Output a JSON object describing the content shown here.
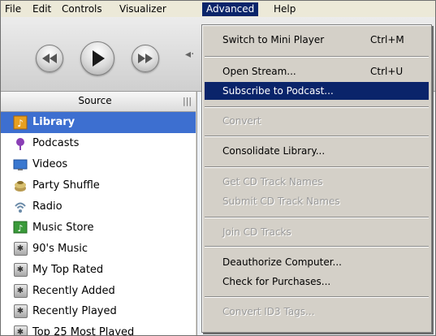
{
  "menubar": {
    "items": [
      {
        "label": "File"
      },
      {
        "label": "Edit"
      },
      {
        "label": "Controls"
      },
      {
        "label": "Visualizer"
      },
      {
        "label": "Advanced"
      },
      {
        "label": "Help"
      }
    ]
  },
  "source": {
    "header": "Source",
    "items": [
      {
        "label": "Library",
        "icon": "library-icon"
      },
      {
        "label": "Podcasts",
        "icon": "podcast-icon"
      },
      {
        "label": "Videos",
        "icon": "video-icon"
      },
      {
        "label": "Party Shuffle",
        "icon": "party-shuffle-icon"
      },
      {
        "label": "Radio",
        "icon": "radio-icon"
      },
      {
        "label": "Music Store",
        "icon": "music-store-icon"
      },
      {
        "label": "90's Music",
        "icon": "smart-playlist-icon"
      },
      {
        "label": "My Top Rated",
        "icon": "smart-playlist-icon"
      },
      {
        "label": "Recently Added",
        "icon": "smart-playlist-icon"
      },
      {
        "label": "Recently Played",
        "icon": "smart-playlist-icon"
      },
      {
        "label": "Top 25 Most Played",
        "icon": "smart-playlist-icon"
      }
    ]
  },
  "advanced_menu": {
    "items": [
      {
        "label": "Switch to Mini Player",
        "shortcut": "Ctrl+M",
        "enabled": true
      },
      {
        "label": "Open Stream...",
        "shortcut": "Ctrl+U",
        "enabled": true
      },
      {
        "label": "Subscribe to Podcast...",
        "shortcut": "",
        "enabled": true,
        "highlighted": true
      },
      {
        "label": "Convert",
        "shortcut": "",
        "enabled": false
      },
      {
        "label": "Consolidate Library...",
        "shortcut": "",
        "enabled": true
      },
      {
        "label": "Get CD Track Names",
        "shortcut": "",
        "enabled": false
      },
      {
        "label": "Submit CD Track Names",
        "shortcut": "",
        "enabled": false
      },
      {
        "label": "Join CD Tracks",
        "shortcut": "",
        "enabled": false
      },
      {
        "label": "Deauthorize Computer...",
        "shortcut": "",
        "enabled": true
      },
      {
        "label": "Check for Purchases...",
        "shortcut": "",
        "enabled": true
      },
      {
        "label": "Convert ID3 Tags...",
        "shortcut": "",
        "enabled": false
      }
    ]
  },
  "colors": {
    "menu_highlight": "#0a246a",
    "source_selection": "#3d6fd0"
  }
}
